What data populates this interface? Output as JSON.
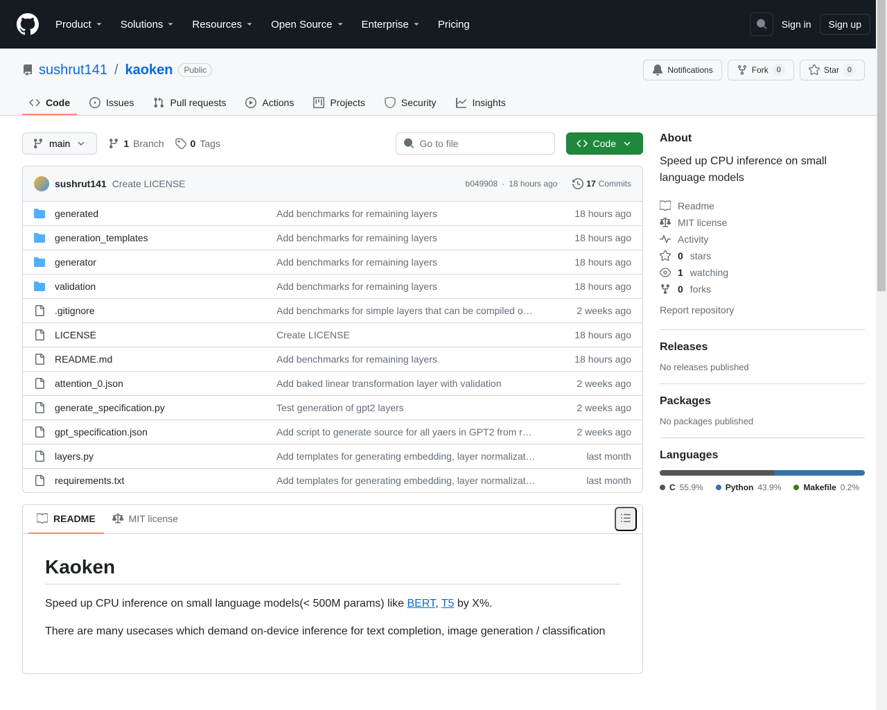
{
  "header": {
    "nav": [
      "Product",
      "Solutions",
      "Resources",
      "Open Source",
      "Enterprise",
      "Pricing"
    ],
    "signin": "Sign in",
    "signup": "Sign up"
  },
  "repo": {
    "owner": "sushrut141",
    "name": "kaoken",
    "visibility": "Public",
    "actions": {
      "notifications": "Notifications",
      "fork": "Fork",
      "fork_count": "0",
      "star": "Star",
      "star_count": "0"
    },
    "tabs": [
      {
        "label": "Code",
        "icon": "code",
        "selected": true
      },
      {
        "label": "Issues",
        "icon": "issues"
      },
      {
        "label": "Pull requests",
        "icon": "pr"
      },
      {
        "label": "Actions",
        "icon": "play"
      },
      {
        "label": "Projects",
        "icon": "project"
      },
      {
        "label": "Security",
        "icon": "shield"
      },
      {
        "label": "Insights",
        "icon": "graph"
      }
    ]
  },
  "toolbar": {
    "branch": "main",
    "branch_count": "1",
    "branch_label": "Branch",
    "tag_count": "0",
    "tag_label": "Tags",
    "goto_placeholder": "Go to file",
    "code_btn": "Code"
  },
  "latest_commit": {
    "author": "sushrut141",
    "message": "Create LICENSE",
    "sha": "b049908",
    "sep": "·",
    "time": "18 hours ago",
    "commits_count": "17",
    "commits_label": "Commits"
  },
  "files": [
    {
      "type": "dir",
      "name": "generated",
      "msg": "Add benchmarks for remaining layers",
      "age": "18 hours ago"
    },
    {
      "type": "dir",
      "name": "generation_templates",
      "msg": "Add benchmarks for remaining layers",
      "age": "18 hours ago"
    },
    {
      "type": "dir",
      "name": "generator",
      "msg": "Add benchmarks for remaining layers",
      "age": "18 hours ago"
    },
    {
      "type": "dir",
      "name": "validation",
      "msg": "Add benchmarks for remaining layers",
      "age": "18 hours ago"
    },
    {
      "type": "file",
      "name": ".gitignore",
      "msg": "Add benchmarks for simple layers that can be compiled o…",
      "age": "2 weeks ago"
    },
    {
      "type": "file",
      "name": "LICENSE",
      "msg": "Create LICENSE",
      "age": "18 hours ago"
    },
    {
      "type": "file",
      "name": "README.md",
      "msg": "Add benchmarks for remaining layers",
      "age": "18 hours ago"
    },
    {
      "type": "file",
      "name": "attention_0.json",
      "msg": "Add baked linear transformation layer with validation",
      "age": "2 weeks ago"
    },
    {
      "type": "file",
      "name": "generate_specification.py",
      "msg": "Test generation of gpt2 layers",
      "age": "2 weeks ago"
    },
    {
      "type": "file",
      "name": "gpt_specification.json",
      "msg": "Add script to generate source for all yaers in GPT2 from r…",
      "age": "2 weeks ago"
    },
    {
      "type": "file",
      "name": "layers.py",
      "msg": "Add templates for generating embedding, layer normalizat…",
      "age": "last month"
    },
    {
      "type": "file",
      "name": "requirements.txt",
      "msg": "Add templates for generating embedding, layer normalizat…",
      "age": "last month"
    }
  ],
  "readme": {
    "tab_readme": "README",
    "tab_license": "MIT license",
    "title": "Kaoken",
    "p1_pre": "Speed up CPU inference on small language models(< 500M params) like ",
    "p1_link1": "BERT",
    "p1_mid": ", ",
    "p1_link2": "T5",
    "p1_post": " by X%.",
    "p2": "There are many usecases which demand on-device inference for text completion, image generation / classification"
  },
  "about": {
    "heading": "About",
    "description": "Speed up CPU inference on small language models",
    "readme": "Readme",
    "license": "MIT license",
    "activity": "Activity",
    "stars_n": "0",
    "stars_l": "stars",
    "watch_n": "1",
    "watch_l": "watching",
    "forks_n": "0",
    "forks_l": "forks",
    "report": "Report repository"
  },
  "releases": {
    "heading": "Releases",
    "none": "No releases published"
  },
  "packages": {
    "heading": "Packages",
    "none": "No packages published"
  },
  "languages": {
    "heading": "Languages",
    "items": [
      {
        "name": "C",
        "pct": "55.9%",
        "color": "#555555",
        "width": "55.9%"
      },
      {
        "name": "Python",
        "pct": "43.9%",
        "color": "#3572A5",
        "width": "43.9%"
      },
      {
        "name": "Makefile",
        "pct": "0.2%",
        "color": "#427819",
        "width": "0.2%"
      }
    ]
  }
}
